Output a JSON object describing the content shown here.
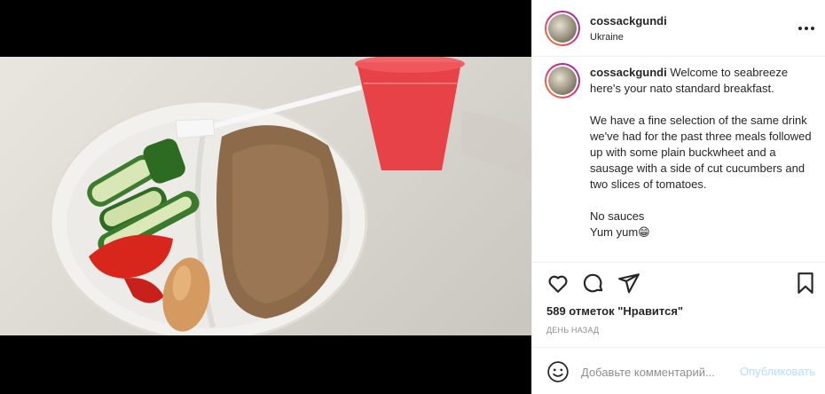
{
  "post": {
    "username": "cossackgundi",
    "location": "Ukraine",
    "more_icon": "more-horizontal-icon",
    "photo_alt": "Plate with buckwheat, sausage, cucumbers, tomato and red drink"
  },
  "caption": {
    "username": "cossackgundi",
    "line1": "Welcome to seabreeze here's your nato standard breakfast.",
    "line2": "We have a fine selection of the same drink we've had for the past three meals followed up with some plain buckwheet and a sausage with a side of cut cucumbers and two slices of tomatoes.",
    "line3": "No sauces",
    "line4": "Yum yum😁"
  },
  "actions": {
    "like_icon": "heart-icon",
    "comment_icon": "comment-icon",
    "share_icon": "paper-plane-icon",
    "save_icon": "bookmark-icon"
  },
  "stats": {
    "likes": "589 отметок \"Нравится\"",
    "date": "ДЕНЬ НАЗАД"
  },
  "add_comment": {
    "emoji_icon": "smiley-icon",
    "placeholder": "Добавьте комментарий...",
    "publish_label": "Опубликовать"
  }
}
